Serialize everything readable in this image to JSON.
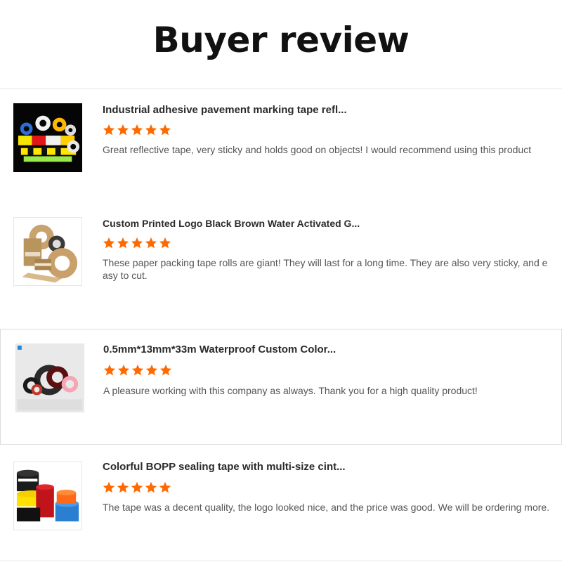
{
  "page": {
    "title": "Buyer review"
  },
  "colors": {
    "star": "#ff6a00",
    "title_text": "#111111",
    "body_text": "#555555"
  },
  "reviews": [
    {
      "product_title": "Industrial adhesive pavement marking tape refl...",
      "rating": 5,
      "text": "Great reflective tape, very sticky and holds good on objects! I would recommend using this product",
      "thumbnail_icon": "reflective-tape-photo"
    },
    {
      "product_title": "Custom Printed Logo Black Brown Water Activated G...",
      "rating": 5,
      "text": "These paper packing tape rolls are giant! They will last for a long time. They are also very sticky, and easy to cut.",
      "thumbnail_icon": "kraft-paper-tape-photo"
    },
    {
      "product_title": "0.5mm*13mm*33m Waterproof Custom Color...",
      "rating": 5,
      "text": "A pleasure working with this company as always. Thank you for a high quality product!",
      "thumbnail_icon": "foam-tape-photo"
    },
    {
      "product_title": "Colorful BOPP sealing tape with multi-size cint...",
      "rating": 5,
      "text": "The tape was a decent quality, the logo looked nice, and the price was good. We will be ordering more.",
      "thumbnail_icon": "bopp-sealing-tape-photo"
    }
  ]
}
